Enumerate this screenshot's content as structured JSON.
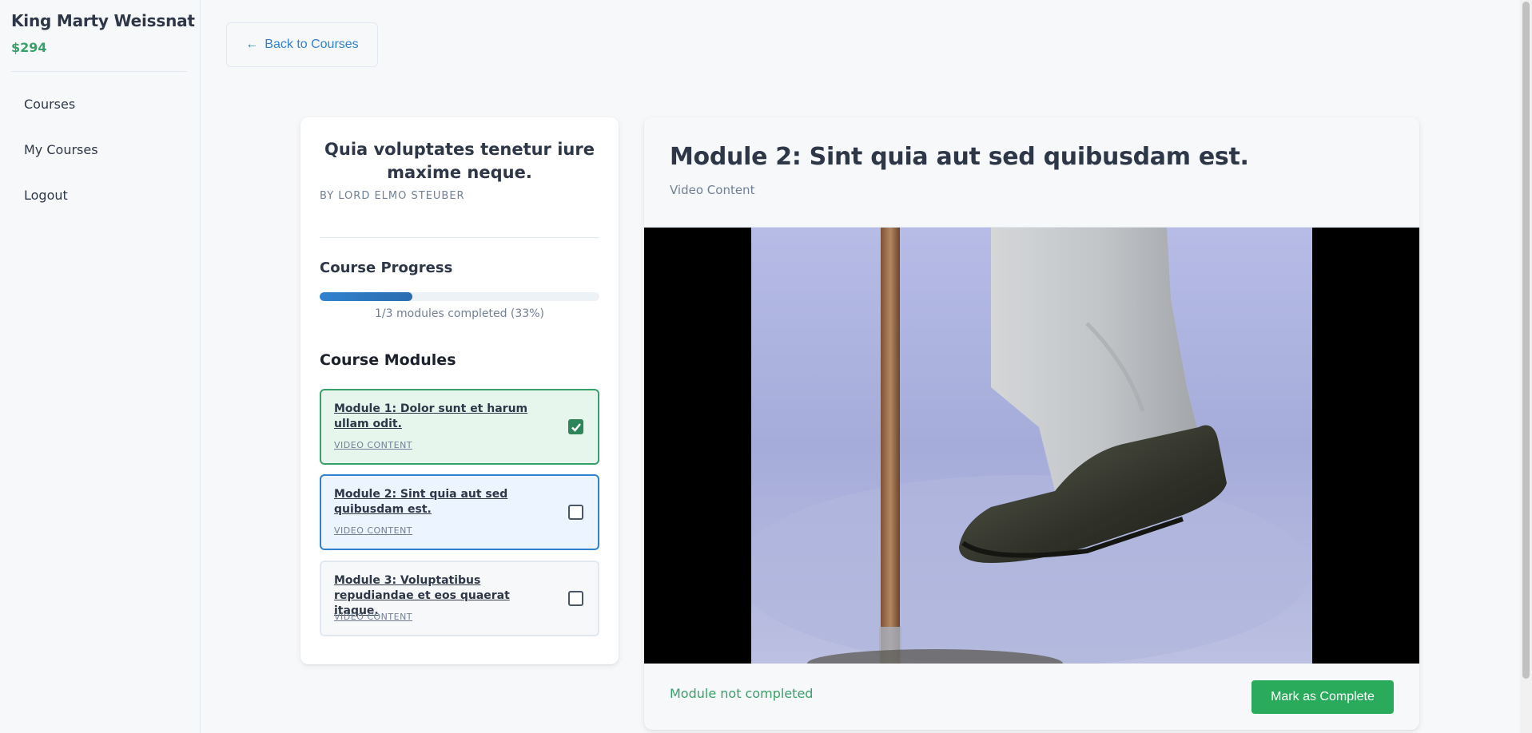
{
  "sidebar": {
    "user_name": "King Marty Weissnat",
    "balance": "$294",
    "nav": [
      {
        "label": "Courses"
      },
      {
        "label": "My Courses"
      },
      {
        "label": "Logout"
      }
    ]
  },
  "header": {
    "back_label": "Back to Courses",
    "back_icon": "arrow-left-icon"
  },
  "course": {
    "title": "Quia voluptates tenetur iure maxime neque.",
    "author": "BY LORD ELMO STEUBER",
    "progress_heading": "Course Progress",
    "progress_fraction": 0.33,
    "progress_text": "1/3 modules completed (33%)",
    "modules_heading": "Course Modules",
    "modules": [
      {
        "title": "Module 1: Dolor sunt et harum ullam odit.",
        "type": "VIDEO CONTENT",
        "completed": true,
        "active": false
      },
      {
        "title": "Module 2: Sint quia aut sed quibusdam est.",
        "type": "VIDEO CONTENT",
        "completed": false,
        "active": true
      },
      {
        "title": "Module 3: Voluptatibus repudiandae et eos quaerat itaque.",
        "type": "VIDEO CONTENT",
        "completed": false,
        "active": false
      }
    ]
  },
  "content": {
    "heading": "Module 2: Sint quia aut sed quibusdam est.",
    "subheading": "Video Content",
    "status_text": "Module not completed",
    "complete_button": "Mark as Complete"
  },
  "colors": {
    "accent_blue": "#3182ce",
    "success_green": "#38a169",
    "button_green": "#2aaa5b"
  }
}
